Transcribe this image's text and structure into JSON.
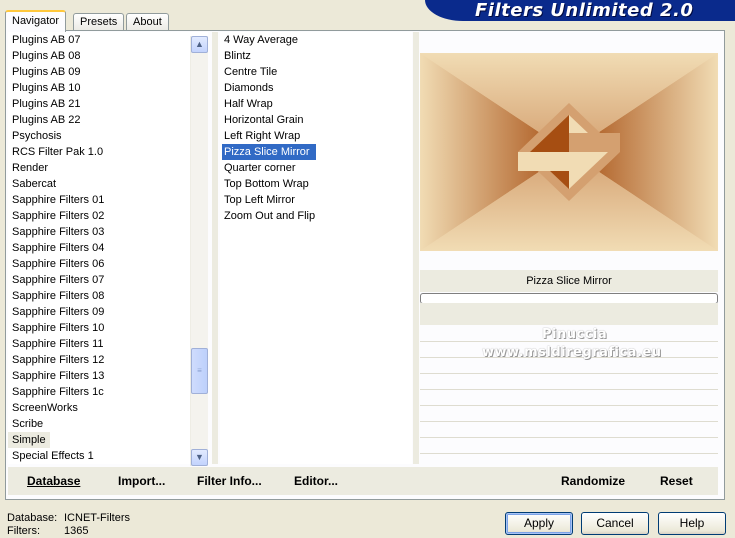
{
  "tabs": [
    "Navigator",
    "Presets",
    "About"
  ],
  "app_title": "Filters Unlimited 2.0",
  "categories": [
    "Plugins AB 07",
    "Plugins AB 08",
    "Plugins AB 09",
    "Plugins AB 10",
    "Plugins AB 21",
    "Plugins AB 22",
    "Psychosis",
    "RCS Filter Pak 1.0",
    "Render",
    "Sabercat",
    "Sapphire Filters 01",
    "Sapphire Filters 02",
    "Sapphire Filters 03",
    "Sapphire Filters 04",
    "Sapphire Filters 06",
    "Sapphire Filters 07",
    "Sapphire Filters 08",
    "Sapphire Filters 09",
    "Sapphire Filters 10",
    "Sapphire Filters 11",
    "Sapphire Filters 12",
    "Sapphire Filters 13",
    "Sapphire Filters 1c",
    "ScreenWorks",
    "Scribe",
    "Simple",
    "Special Effects 1"
  ],
  "selected_category": "Simple",
  "filters": [
    "4 Way Average",
    "Blintz",
    "Centre Tile",
    "Diamonds",
    "Half Wrap",
    "Horizontal Grain",
    "Left Right Wrap",
    "Pizza Slice Mirror",
    "Quarter corner",
    "Top Bottom Wrap",
    "Top Left Mirror",
    "Zoom Out and Flip"
  ],
  "selected_filter": "Pizza Slice Mirror",
  "preview": {
    "filter_name": "Pizza Slice Mirror",
    "progress": 0,
    "watermark_line1": "Pinuccia",
    "watermark_line2": "www.msldiregrafica.eu",
    "colors": {
      "light": "#f1dcb4",
      "mid": "#d4a070",
      "dark": "#a64e12"
    }
  },
  "toolbar": {
    "database": "Database",
    "import": "Import...",
    "filter_info": "Filter Info...",
    "editor": "Editor...",
    "randomize": "Randomize",
    "reset": "Reset"
  },
  "status": {
    "database_label": "Database:",
    "database_value": "ICNET-Filters",
    "filters_label": "Filters:",
    "filters_value": "1365"
  },
  "buttons": {
    "apply": "Apply",
    "cancel": "Cancel",
    "help": "Help"
  }
}
